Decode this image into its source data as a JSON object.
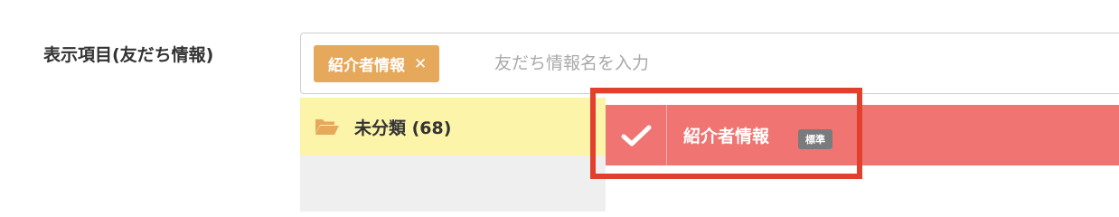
{
  "form": {
    "field_label": "表示項目(友だち情報)"
  },
  "tag_input": {
    "chips": [
      {
        "label": "紹介者情報",
        "remove_glyph": "✕"
      }
    ],
    "placeholder": "友だち情報名を入力",
    "value": ""
  },
  "categories": [
    {
      "label": "未分類 (68)",
      "icon": "folder-open-icon",
      "selected": true
    }
  ],
  "items": [
    {
      "name": "紹介者情報",
      "badge": "標準",
      "checked": true,
      "icon": "checkmark-icon"
    }
  ],
  "colors": {
    "chip_bg": "#e6a85a",
    "category_selected_bg": "#fcf4a8",
    "category_panel_bg": "#efefef",
    "item_selected_bg": "#ef7472",
    "badge_bg": "#7b7b7b",
    "highlight_border": "#e2402c",
    "folder_icon": "#e6a85a"
  }
}
